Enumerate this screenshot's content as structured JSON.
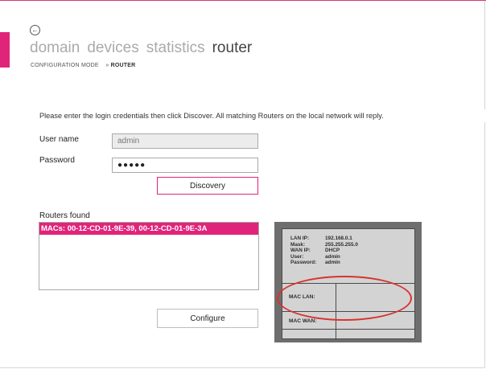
{
  "colors": {
    "accent": "#e0247a",
    "highlight_ring": "#d8332f"
  },
  "nav": {
    "back_icon": "back-arrow-icon",
    "items": [
      {
        "label": "domain"
      },
      {
        "label": "devices"
      },
      {
        "label": "statistics"
      },
      {
        "label": "router",
        "active": true
      }
    ]
  },
  "breadcrumb": {
    "root": "CONFIGURATION MODE",
    "separator": "»",
    "current": "ROUTER"
  },
  "instructions": "Please enter the login credentials then click Discover. All matching Routers on the local network will reply.",
  "form": {
    "username_label": "User name",
    "username_value": "admin",
    "password_label": "Password",
    "password_value": "●●●●●",
    "discover_button": "Discovery"
  },
  "routers": {
    "label": "Routers found",
    "items": [
      "MACs: 00-12-CD-01-9E-39, 00-12-CD-01-9E-3A"
    ]
  },
  "configure_button": "Configure",
  "sticker": {
    "rows": [
      {
        "key": "LAN IP:",
        "value": "192.168.0.1"
      },
      {
        "key": "Mask:",
        "value": "255.255.255.0"
      },
      {
        "key": "WAN IP:",
        "value": "DHCP"
      },
      {
        "key": "User:",
        "value": "admin"
      },
      {
        "key": "Password:",
        "value": "admin"
      }
    ],
    "mac_lan_label": "MAC LAN:",
    "mac_wan_label": "MAC WAN:"
  }
}
